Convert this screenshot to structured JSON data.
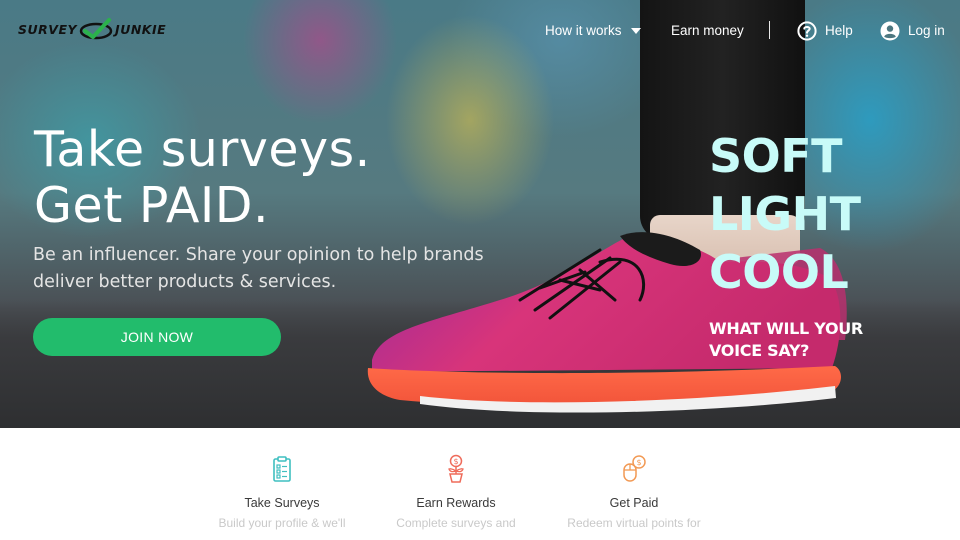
{
  "brand": {
    "logo_text_left": "SURVEY",
    "logo_text_right": "JUNKIE"
  },
  "nav": {
    "how_it_works": "How it works",
    "earn_money": "Earn money",
    "help": "Help",
    "login": "Log in"
  },
  "hero": {
    "headline": "Take surveys.\nGet PAID.",
    "subhead": "Be an influencer. Share your opinion to help brands deliver better products & services.",
    "cta": "JOIN NOW"
  },
  "promo": {
    "lines": [
      "SOFT",
      "LIGHT",
      "COOL"
    ],
    "tagline": "WHAT WILL YOUR\nVOICE SAY?"
  },
  "features": [
    {
      "icon": "clipboard-icon",
      "title": "Take Surveys",
      "desc": "Build your profile & we'll"
    },
    {
      "icon": "money-plant-icon",
      "title": "Earn Rewards",
      "desc": "Complete surveys and"
    },
    {
      "icon": "mouse-coin-icon",
      "title": "Get Paid",
      "desc": "Redeem virtual points for"
    }
  ],
  "colors": {
    "cta_green": "#22bc6c",
    "promo_mint": "#c8fbf8",
    "icon_teal": "#3fbfc0",
    "icon_coral": "#ef6b5a",
    "icon_orange": "#f29a55"
  }
}
